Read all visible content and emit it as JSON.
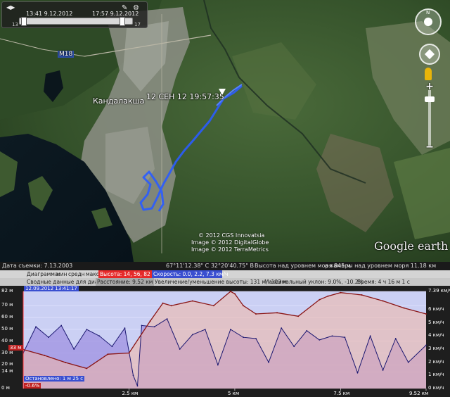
{
  "time_slider": {
    "start_time": "13:41 9.12.2012",
    "end_time": "17:57 9.12.2012",
    "start_count": "13",
    "end_count": "17",
    "position": 0.92
  },
  "map": {
    "road_label": "M18",
    "city_label": "Кандалакша",
    "track_label": "12 СЕН 12 19:57:35",
    "credits": [
      "© 2012 CGS Innovatsia",
      "Image © 2012 DigitalGlobe",
      "Image © 2012 TerraMetrics"
    ],
    "brand": "Google earth"
  },
  "nav": {
    "zoom_in": "+",
    "zoom_out": "−",
    "zoom_level": 0.12
  },
  "status_bar": {
    "imagery_date": "Дата съемки: 7.13.2003",
    "coords": "67°11'12.38\" С 32°20'40.75\" В",
    "elevation": "Высота над уровнем моря 845 м",
    "eye_alt": "а камеры над уровнем моря 11.18 км"
  },
  "profile": {
    "row1": {
      "diagram_label": "Диаграмма:",
      "min": "мин",
      "avg": "средн",
      "max": "макс",
      "altitude": "Высота: 14, 56, 82 м",
      "speed": "Скорость: 0.0, 2.2, 7.3 км/ч"
    },
    "row2": {
      "summary_label": "Сводные данные для диапазона:",
      "distance": "Расстояние: 9.52 км",
      "gain_loss": "Увеличение/уменьшение высоты: 131 м, -103 м",
      "max_slope": "Максимальный уклон: 9.0%, -10.2%",
      "time": "Время: 4 ч 16 м 1 с"
    },
    "cursor_time": "12.09.2012 13:41:17",
    "left_axis": [
      "82 м",
      "70 м",
      "60 м",
      "50 м",
      "40 м",
      "30 м",
      "20 м",
      "14 м",
      "0 м"
    ],
    "right_axis": [
      "7.39 км/ч",
      "6 км/ч",
      "5 км/ч",
      "4 км/ч",
      "3 км/ч",
      "2 км/ч",
      "1 км/ч",
      "0 км/ч"
    ],
    "bottom_axis": [
      "2.5 км",
      "5 км",
      "7.5 км",
      "9.52 км"
    ],
    "marker_altitude": "33 м",
    "marker_slope": "-0.6%",
    "stopped_label": "Остановлено: 1 м 25 с"
  },
  "chart_data": {
    "type": "line",
    "xlabel": "",
    "ylabel": "",
    "x_range_km": [
      0,
      9.52
    ],
    "altitude_ylim": [
      0,
      82
    ],
    "speed_ylim": [
      0,
      7.39
    ],
    "series": [
      {
        "name": "Высота",
        "units": "м",
        "x": [
          0,
          0.5,
          1.0,
          1.5,
          2.0,
          2.5,
          3.0,
          3.3,
          3.5,
          4.0,
          4.5,
          4.9,
          5.0,
          5.2,
          5.5,
          6.0,
          6.5,
          7.0,
          7.2,
          7.5,
          8.0,
          8.5,
          9.0,
          9.52
        ],
        "values": [
          33,
          28,
          22,
          17,
          29,
          30,
          57,
          72,
          70,
          74,
          70,
          82,
          80,
          70,
          63,
          64,
          61,
          75,
          78,
          81,
          79,
          74,
          68,
          63
        ]
      },
      {
        "name": "Скорость",
        "units": "км/ч",
        "x": [
          0,
          0.3,
          0.6,
          0.9,
          1.2,
          1.5,
          1.8,
          2.1,
          2.4,
          2.6,
          2.7,
          2.8,
          3.1,
          3.4,
          3.7,
          4.0,
          4.3,
          4.6,
          4.9,
          5.2,
          5.5,
          5.8,
          6.1,
          6.4,
          6.7,
          7.0,
          7.3,
          7.6,
          7.9,
          8.2,
          8.5,
          8.8,
          9.1,
          9.52
        ],
        "values": [
          2.7,
          4.7,
          3.9,
          4.8,
          3.0,
          4.5,
          4.0,
          3.2,
          4.6,
          1.0,
          0.2,
          4.8,
          4.7,
          5.3,
          3.0,
          4.1,
          4.5,
          1.8,
          4.5,
          3.9,
          3.8,
          2.0,
          4.6,
          3.2,
          4.4,
          3.7,
          4.0,
          3.9,
          1.2,
          4.0,
          1.4,
          3.8,
          2.0,
          3.3
        ]
      }
    ]
  }
}
